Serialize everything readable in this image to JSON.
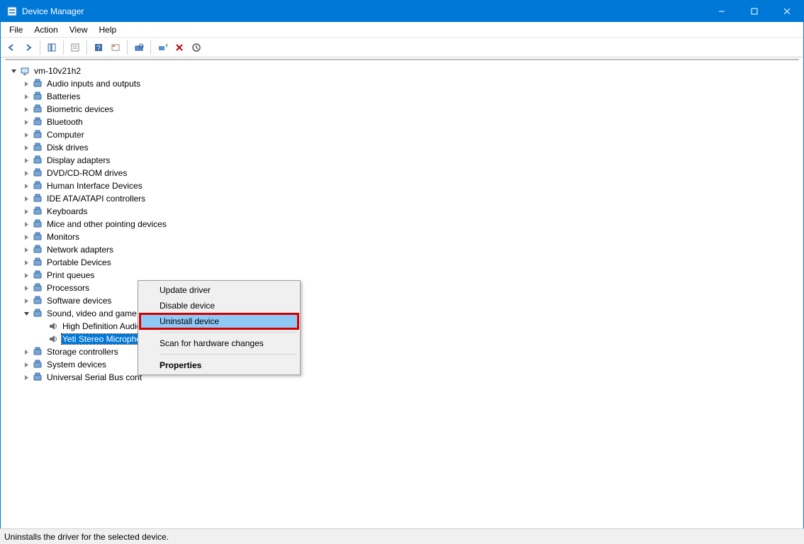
{
  "window": {
    "title": "Device Manager"
  },
  "menubar": {
    "items": [
      "File",
      "Action",
      "View",
      "Help"
    ]
  },
  "toolbar": {
    "icons": [
      "back-icon",
      "forward-icon",
      "sep",
      "show-hide-tree-icon",
      "sep",
      "properties-icon",
      "sep",
      "help-icon",
      "show-hidden-icon",
      "sep",
      "scan-hardware-icon",
      "sep",
      "add-legacy-icon",
      "remove-icon",
      "update-icon"
    ]
  },
  "tree": {
    "root": "vm-10v21h2",
    "categories": [
      {
        "label": "Audio inputs and outputs",
        "expanded": false
      },
      {
        "label": "Batteries",
        "expanded": false
      },
      {
        "label": "Biometric devices",
        "expanded": false
      },
      {
        "label": "Bluetooth",
        "expanded": false
      },
      {
        "label": "Computer",
        "expanded": false
      },
      {
        "label": "Disk drives",
        "expanded": false
      },
      {
        "label": "Display adapters",
        "expanded": false
      },
      {
        "label": "DVD/CD-ROM drives",
        "expanded": false
      },
      {
        "label": "Human Interface Devices",
        "expanded": false
      },
      {
        "label": "IDE ATA/ATAPI controllers",
        "expanded": false
      },
      {
        "label": "Keyboards",
        "expanded": false
      },
      {
        "label": "Mice and other pointing devices",
        "expanded": false
      },
      {
        "label": "Monitors",
        "expanded": false
      },
      {
        "label": "Network adapters",
        "expanded": false
      },
      {
        "label": "Portable Devices",
        "expanded": false
      },
      {
        "label": "Print queues",
        "expanded": false
      },
      {
        "label": "Processors",
        "expanded": false
      },
      {
        "label": "Software devices",
        "expanded": false
      },
      {
        "label": "Sound, video and game controllers",
        "expanded": true,
        "children": [
          {
            "label": "High Definition Audio Device",
            "selected": false
          },
          {
            "label": "Yeti Stereo Microphone",
            "selected": true
          }
        ]
      },
      {
        "label": "Storage controllers",
        "expanded": false
      },
      {
        "label": "System devices",
        "expanded": false
      },
      {
        "label": "Universal Serial Bus controllers",
        "expanded": false,
        "truncated": true,
        "display": "Universal Serial Bus cont"
      }
    ]
  },
  "context_menu": {
    "items": [
      {
        "label": "Update driver",
        "highlighted": false
      },
      {
        "label": "Disable device",
        "highlighted": false
      },
      {
        "label": "Uninstall device",
        "highlighted": true,
        "red_frame": true
      },
      {
        "separator": true
      },
      {
        "label": "Scan for hardware changes",
        "highlighted": false
      },
      {
        "separator": true
      },
      {
        "label": "Properties",
        "highlighted": false,
        "bold": true
      }
    ]
  },
  "statusbar": {
    "text": "Uninstalls the driver for the selected device."
  }
}
